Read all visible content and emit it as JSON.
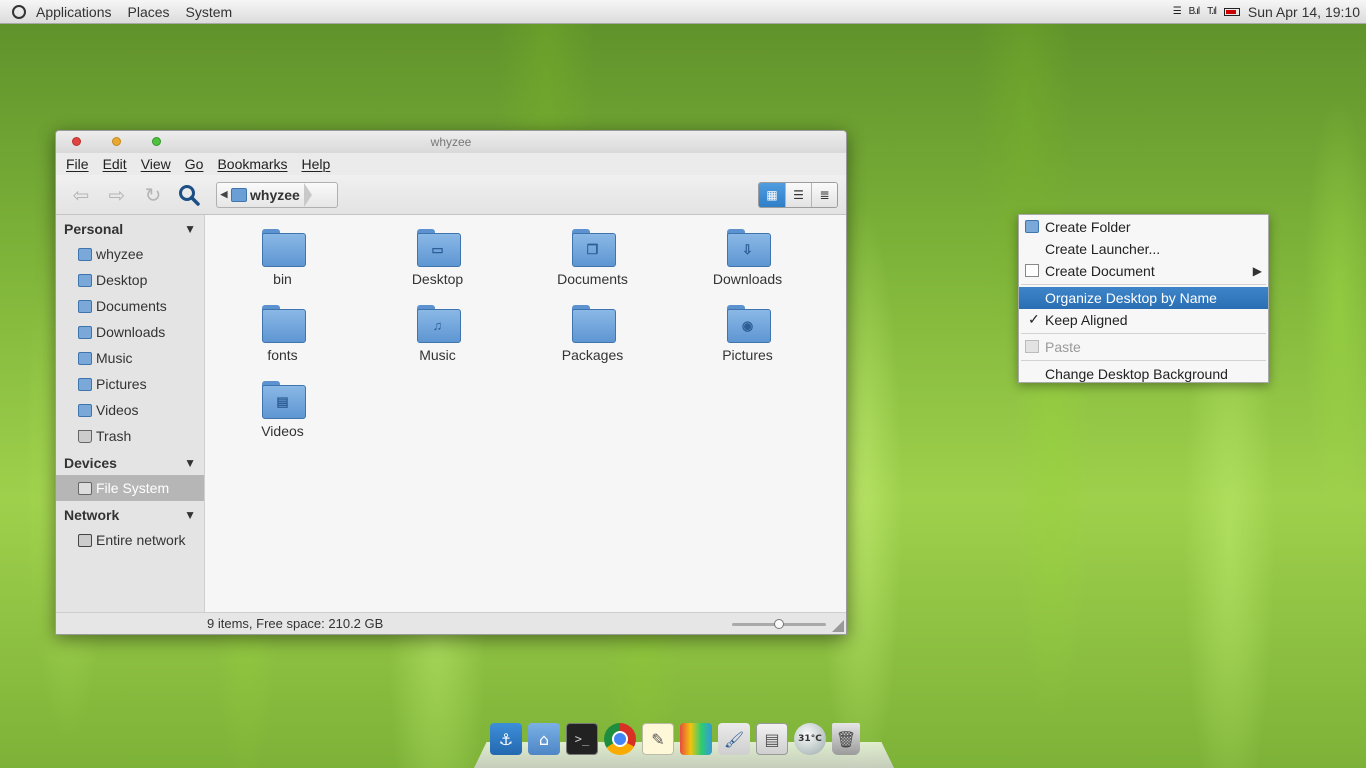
{
  "top_panel": {
    "menus": [
      "Applications",
      "Places",
      "System"
    ],
    "clock": "Sun Apr 14, 19:10",
    "tray": [
      "menu-icon",
      "network-signal-icon",
      "wifi-signal-icon",
      "battery-icon"
    ]
  },
  "window": {
    "title": "whyzee",
    "menu": {
      "file": "File",
      "edit": "Edit",
      "view": "View",
      "go": "Go",
      "bookmarks": "Bookmarks",
      "help": "Help"
    },
    "path": {
      "current": "whyzee"
    },
    "sidebar": {
      "personal": {
        "header": "Personal",
        "items": [
          "whyzee",
          "Desktop",
          "Documents",
          "Downloads",
          "Music",
          "Pictures",
          "Videos",
          "Trash"
        ]
      },
      "devices": {
        "header": "Devices",
        "items": [
          "File System"
        ]
      },
      "network": {
        "header": "Network",
        "items": [
          "Entire network"
        ]
      }
    },
    "files": [
      "bin",
      "Desktop",
      "Documents",
      "Downloads",
      "fonts",
      "Music",
      "Packages",
      "Pictures",
      "Videos"
    ],
    "status": "9 items, Free space: 210.2 GB",
    "zoom_level": 0.5,
    "active_view": "icon-view"
  },
  "context_menu": {
    "items": [
      {
        "label": "Create Folder",
        "icon": "folder-icon"
      },
      {
        "label": "Create Launcher...",
        "icon": ""
      },
      {
        "label": "Create Document",
        "icon": "document-icon",
        "submenu": true
      },
      {
        "label": "Organize Desktop by Name",
        "highlighted": true
      },
      {
        "label": "Keep Aligned",
        "checked": true
      },
      {
        "label": "Paste",
        "icon": "paste-icon",
        "disabled": true
      },
      {
        "label": "Change Desktop Background"
      }
    ]
  },
  "dock": {
    "weather_text": "31°C",
    "icons": [
      "anchor-icon",
      "home-folder-icon",
      "terminal-icon",
      "chrome-icon",
      "notes-icon",
      "palette-icon",
      "paint-brush-icon",
      "file-cabinet-icon",
      "weather-icon",
      "trash-icon"
    ]
  },
  "colors": {
    "accent": "#2f7fc8",
    "folder": "#6a9fd6",
    "menu_highlight": "#2a6fb4"
  }
}
